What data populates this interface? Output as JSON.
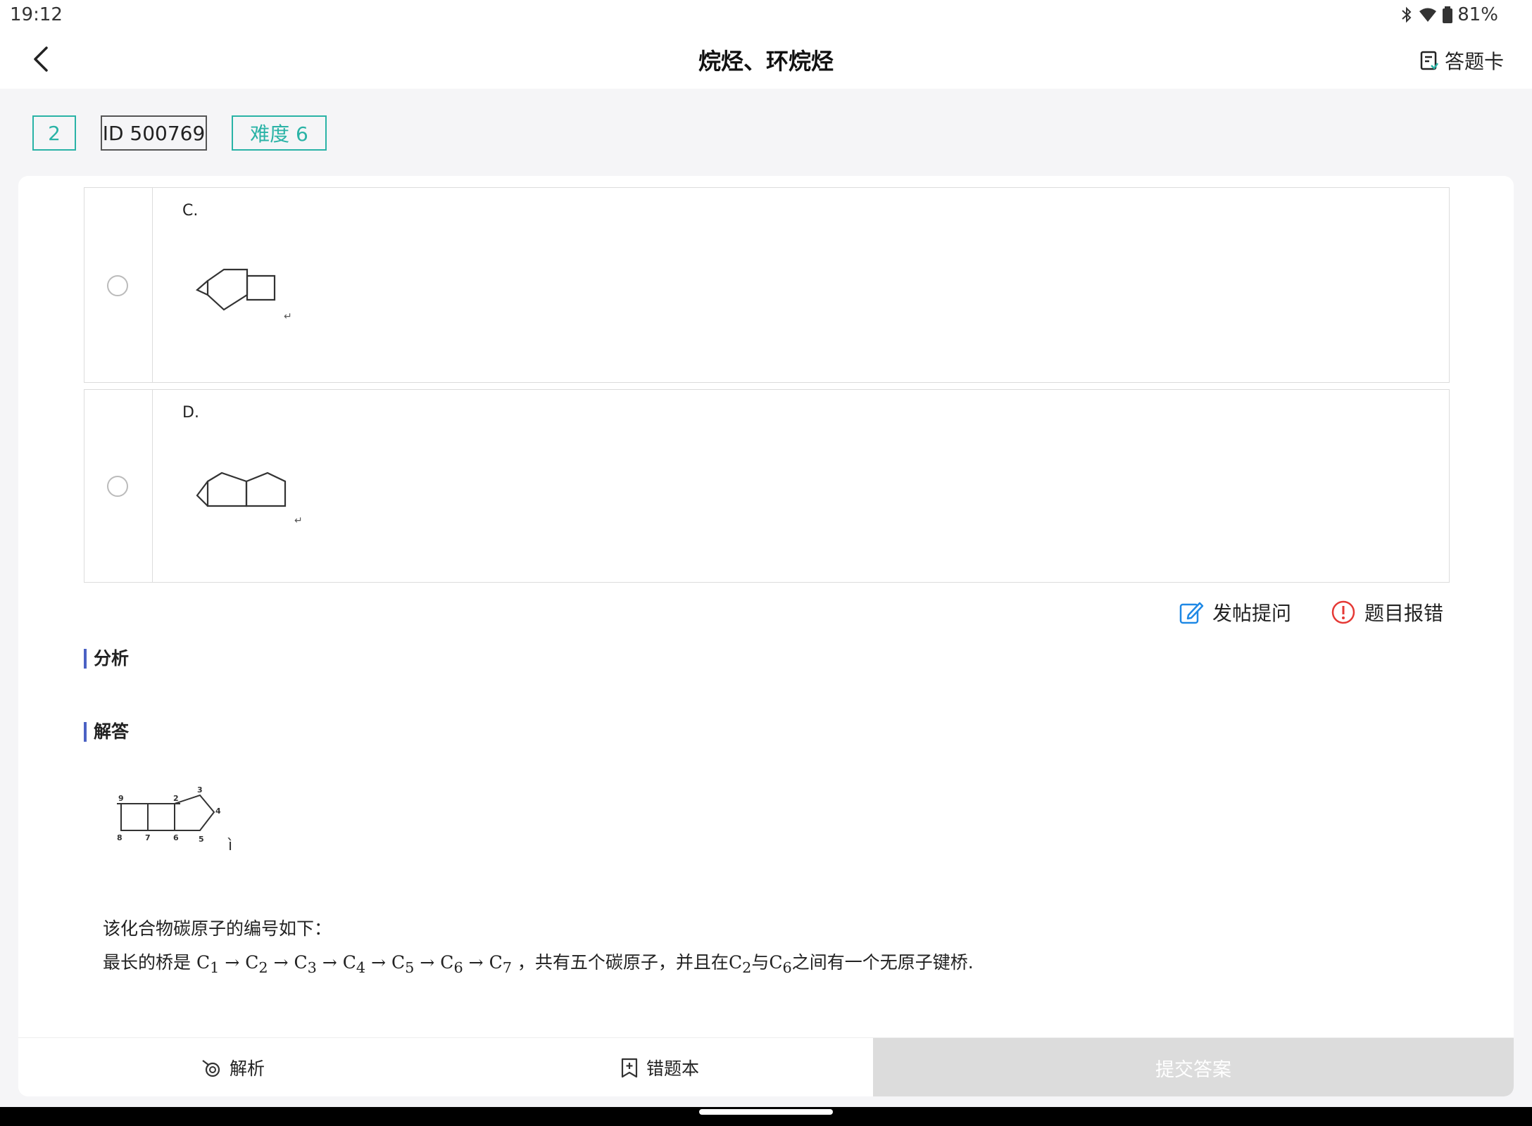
{
  "status": {
    "time": "19:12",
    "battery": "81%"
  },
  "header": {
    "title": "烷烃、环烷烃",
    "answer_card": "答题卡"
  },
  "tags": {
    "number": "2",
    "id": "ID 500769",
    "difficulty": "难度 6"
  },
  "options": [
    {
      "letter": "C."
    },
    {
      "letter": "D."
    }
  ],
  "actions": {
    "ask": "发帖提问",
    "report": "题目报错"
  },
  "sections": {
    "analysis": "分析",
    "answer": "解答"
  },
  "figure": {
    "labels": [
      "9",
      "8",
      "7",
      "6",
      "2",
      "3",
      "4",
      "5"
    ],
    "trailing_mark": "ì"
  },
  "answer": {
    "line1": "该化合物碳原子的编号如下：",
    "line2_prefix": "最长的桥是",
    "chain": [
      "C",
      "1",
      "C",
      "2",
      "C",
      "3",
      "C",
      "4",
      "C",
      "5",
      "C",
      "6",
      "C",
      "7"
    ],
    "arrow": "→",
    "line2_mid": "，共有五个碳原子，并且在",
    "c2": "C",
    "c2_sub": "2",
    "with": "与",
    "c6": "C",
    "c6_sub": "6",
    "line2_suffix": "之间有一个无原子键桥."
  },
  "bottom": {
    "analysis": "解析",
    "wrongbook": "错题本",
    "submit": "提交答案"
  }
}
